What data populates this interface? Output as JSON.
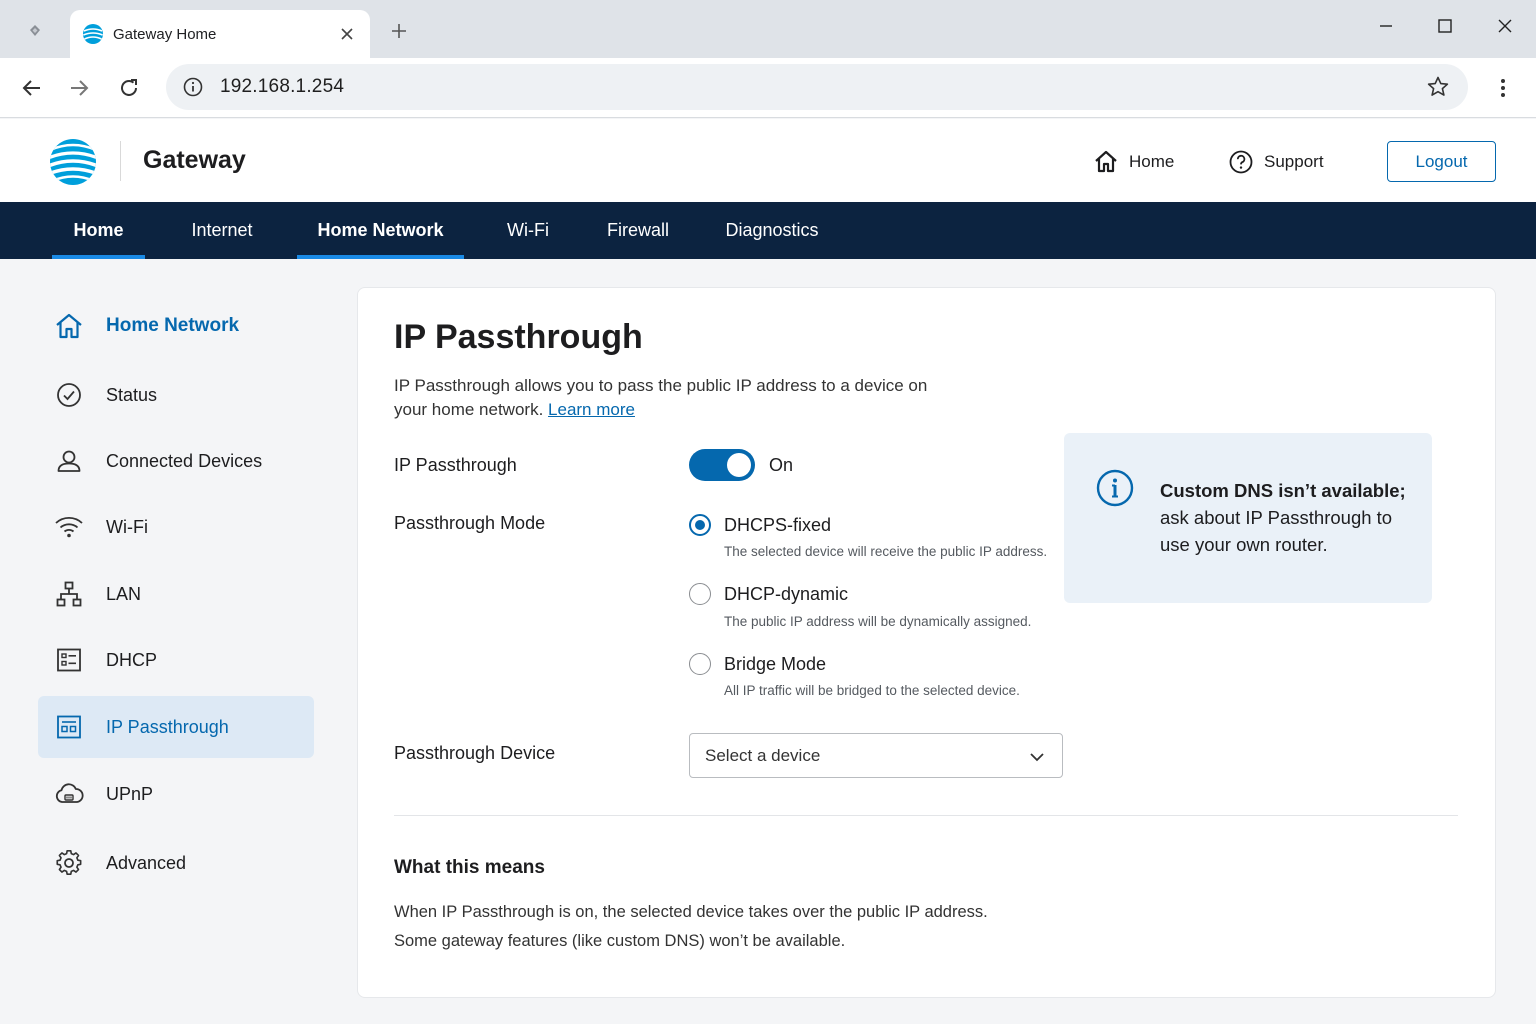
{
  "browser": {
    "tab_title": "Gateway Home",
    "url": "192.168.1.254"
  },
  "header": {
    "brand": "Gateway",
    "home_link": "Home",
    "support_link": "Support",
    "logout_label": "Logout"
  },
  "nav": {
    "items": [
      {
        "label": "Home",
        "active": true
      },
      {
        "label": "Internet",
        "active": false
      },
      {
        "label": "Home Network",
        "active": true
      },
      {
        "label": "Wi-Fi",
        "active": false
      },
      {
        "label": "Firewall",
        "active": false
      },
      {
        "label": "Diagnostics",
        "active": false
      }
    ]
  },
  "sidebar": {
    "header": {
      "label": "Home Network",
      "icon": "house-icon"
    },
    "items": [
      {
        "label": "Status",
        "icon": "check-circle-icon"
      },
      {
        "label": "Connected Devices",
        "icon": "user-icon"
      },
      {
        "label": "Wi-Fi",
        "icon": "wifi-icon"
      },
      {
        "label": "LAN",
        "icon": "network-tree-icon"
      },
      {
        "label": "DHCP",
        "icon": "list-box-icon"
      },
      {
        "label": "IP Passthrough",
        "icon": "passthrough-icon",
        "selected": true
      },
      {
        "label": "UPnP",
        "icon": "cloud-icon"
      },
      {
        "label": "Advanced",
        "icon": "gear-icon"
      }
    ]
  },
  "main": {
    "title": "IP Passthrough",
    "description": "IP Passthrough allows you to pass the public IP address to a device on your home network.",
    "learn_more": "Learn more",
    "passthrough_label": "IP Passthrough",
    "passthrough_state": "On",
    "mode_label": "Passthrough Mode",
    "modes": [
      {
        "label": "DHCPS-fixed",
        "help": "The selected device will receive the public IP address.",
        "checked": true
      },
      {
        "label": "DHCP-dynamic",
        "help": "The public IP address will be dynamically assigned.",
        "checked": false
      },
      {
        "label": "Bridge Mode",
        "help": "All IP traffic will be bridged to the selected device.",
        "checked": false
      }
    ],
    "device_label": "Passthrough Device",
    "device_placeholder": "Select a device",
    "info_bold": "Custom DNS isn’t available;",
    "info_rest": "ask about IP Passthrough to use your own router.",
    "section_title": "What this means",
    "section_line1": "When IP Passthrough is on, the selected device takes over the public IP address.",
    "section_line2": "Some gateway features (like custom DNS) won’t be available."
  },
  "colors": {
    "brand_blue": "#0568ae",
    "nav_bg": "#0c2340",
    "nav_indicator": "#1a8ae5",
    "selected_bg": "#dde9f5",
    "info_bg": "#eaf1f8"
  }
}
